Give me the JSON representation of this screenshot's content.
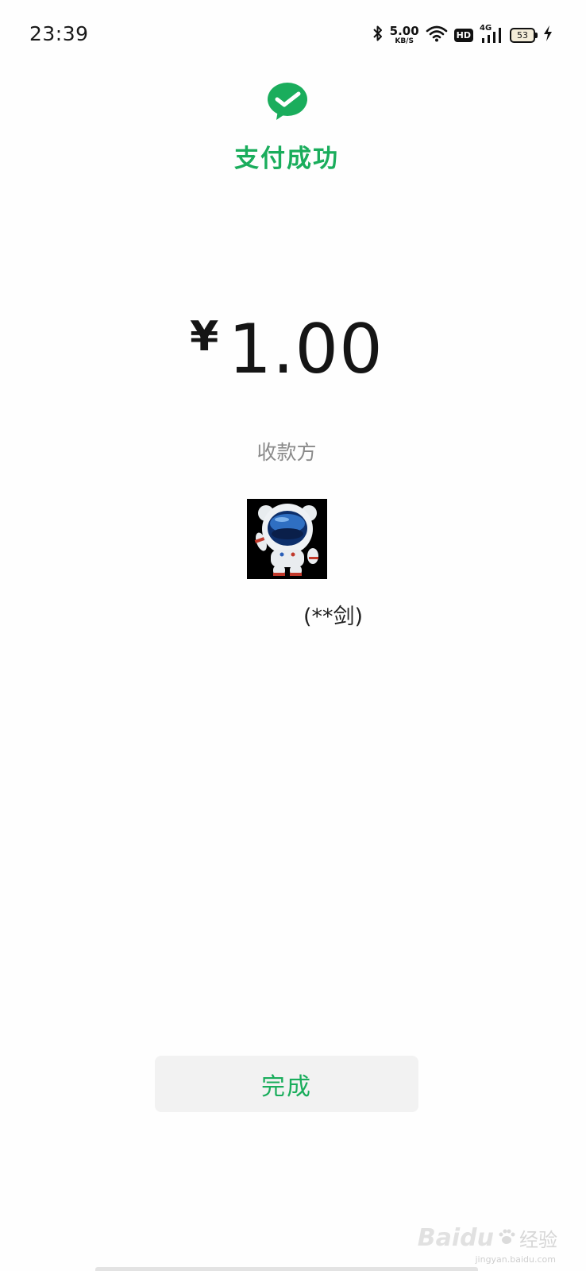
{
  "status_bar": {
    "time": "23:39",
    "net_speed_value": "5.00",
    "net_speed_unit": "KB/S",
    "hd_label": "HD",
    "network_type": "4G",
    "battery_level": "53",
    "icons": [
      "bluetooth-icon",
      "wifi-icon",
      "signal-icon",
      "battery-icon",
      "charging-icon"
    ]
  },
  "payment": {
    "title": "支付成功",
    "currency_symbol": "¥",
    "amount": "1.00",
    "payee_label": "收款方",
    "payee_name": "(**剑)",
    "brand_color": "#1aad5c"
  },
  "actions": {
    "done_label": "完成"
  },
  "watermark": {
    "brand": "Baidu",
    "text": "经验",
    "sub": "jingyan.baidu.com"
  }
}
